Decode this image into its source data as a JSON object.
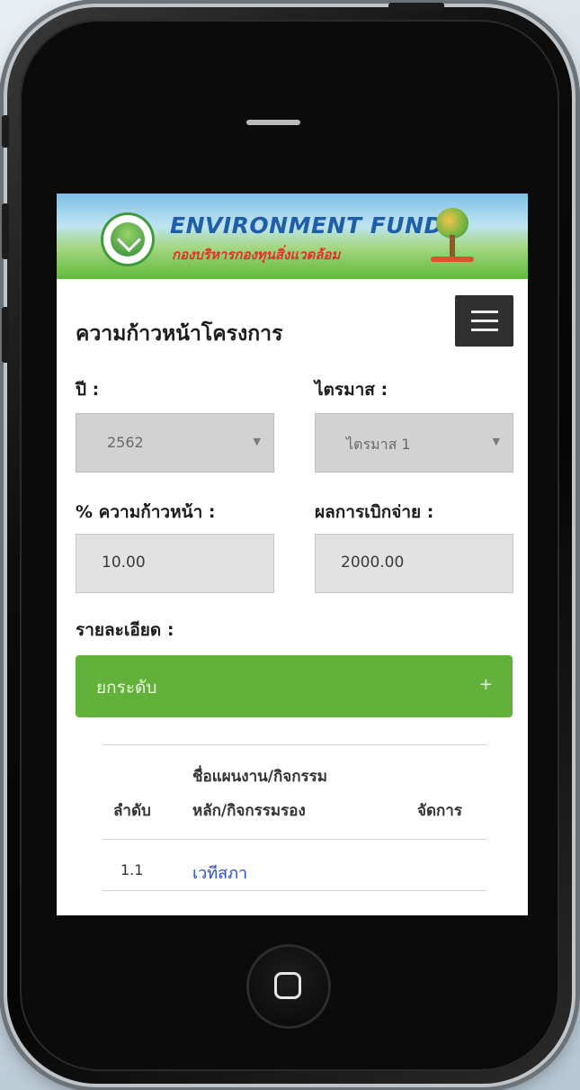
{
  "header": {
    "brand_title": "ENVIRONMENT  FUND",
    "brand_subtitle": "กองบริหารกองทุนสิ่งแวดล้อม"
  },
  "page": {
    "title": "ความก้าวหน้าโครงการ"
  },
  "form": {
    "year": {
      "label": "ปี :",
      "value": "2562"
    },
    "quarter": {
      "label": "ไตรมาส :",
      "value": "ไตรมาส 1"
    },
    "progress": {
      "label": "% ความก้าวหน้า :",
      "value": "10.00"
    },
    "disbursement": {
      "label": "ผลการเบิกจ่าย :",
      "value": "2000.00"
    },
    "details_label": "รายละเอียด :"
  },
  "accordion": {
    "label": "ยกระดับ",
    "toggle": "+"
  },
  "table": {
    "headers": {
      "order": "ลำดับ",
      "name_line1": "ชื่อแผนงาน/กิจกรรม",
      "name_line2": "หลัก/กิจกรรมรอง",
      "action": "จัดการ"
    },
    "rows": [
      {
        "order": "1.1",
        "name": "เวทีสภา"
      }
    ]
  },
  "colors": {
    "accordion_green": "#62b13a",
    "link_blue": "#2b49c4",
    "brand_blue": "#1f5fa8",
    "brand_red": "#e0322d"
  }
}
